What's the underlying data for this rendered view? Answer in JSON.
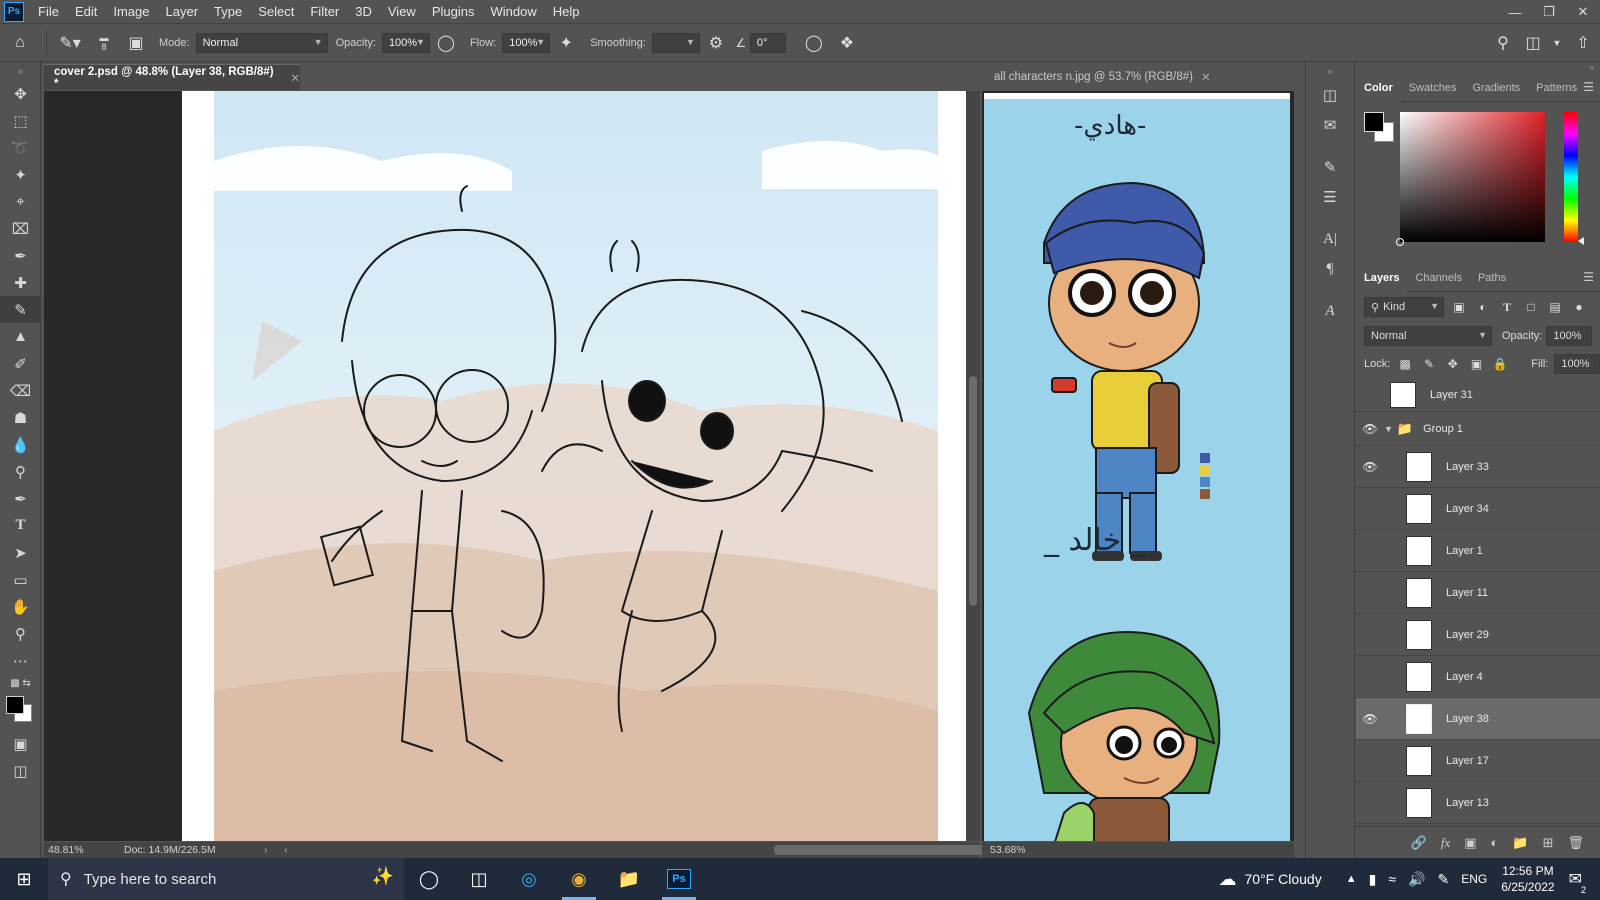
{
  "app": {
    "logo": "Ps"
  },
  "menu": [
    "File",
    "Edit",
    "Image",
    "Layer",
    "Type",
    "Select",
    "Filter",
    "3D",
    "View",
    "Plugins",
    "Window",
    "Help"
  ],
  "options_bar": {
    "brush_size": "8",
    "mode_label": "Mode:",
    "mode_value": "Normal",
    "opacity_label": "Opacity:",
    "opacity_value": "100%",
    "flow_label": "Flow:",
    "flow_value": "100%",
    "smoothing_label": "Smoothing:",
    "smoothing_value": "",
    "angle_value": "0°"
  },
  "documents": [
    {
      "tab": "cover 2.psd @ 48.8% (Layer 38, RGB/8#) *",
      "zoom": "48.81%",
      "doc_info": "Doc: 14.9M/226.5M"
    },
    {
      "tab": "all characters n.jpg @ 53.7% (RGB/8#)",
      "zoom": "53.68%",
      "label_top": "-هادي-",
      "label_bottom": "_ خالد _"
    }
  ],
  "color_panel": {
    "tabs": [
      "Color",
      "Swatches",
      "Gradients",
      "Patterns"
    ],
    "fg": "#000000",
    "bg": "#ffffff"
  },
  "layers_panel": {
    "tabs": [
      "Layers",
      "Channels",
      "Paths"
    ],
    "filter": "Kind",
    "blend_mode": "Normal",
    "opacity_label": "Opacity:",
    "opacity": "100%",
    "lock_label": "Lock:",
    "fill_label": "Fill:",
    "fill": "100%",
    "layers": [
      {
        "name": "Layer 31",
        "visible": false,
        "indent": 0
      },
      {
        "name": "Group 1",
        "visible": true,
        "indent": 0,
        "group": true
      },
      {
        "name": "Layer 33",
        "visible": true,
        "indent": 1
      },
      {
        "name": "Layer 34",
        "visible": false,
        "indent": 1
      },
      {
        "name": "Layer 1",
        "visible": false,
        "indent": 1
      },
      {
        "name": "Layer 11",
        "visible": false,
        "indent": 1
      },
      {
        "name": "Layer 29",
        "visible": false,
        "indent": 1
      },
      {
        "name": "Layer 4",
        "visible": false,
        "indent": 1
      },
      {
        "name": "Layer 38",
        "visible": true,
        "indent": 1,
        "selected": true
      },
      {
        "name": "Layer 17",
        "visible": false,
        "indent": 1
      },
      {
        "name": "Layer 13",
        "visible": false,
        "indent": 1
      }
    ]
  },
  "taskbar": {
    "search_placeholder": "Type here to search",
    "weather": "70°F Cloudy",
    "language": "ENG",
    "time": "12:56 PM",
    "date": "6/25/2022",
    "notification_count": "2"
  },
  "colors": {
    "panel": "#535353",
    "accent": "#31a8ff",
    "canvas_sky": "#9ad3ea"
  }
}
